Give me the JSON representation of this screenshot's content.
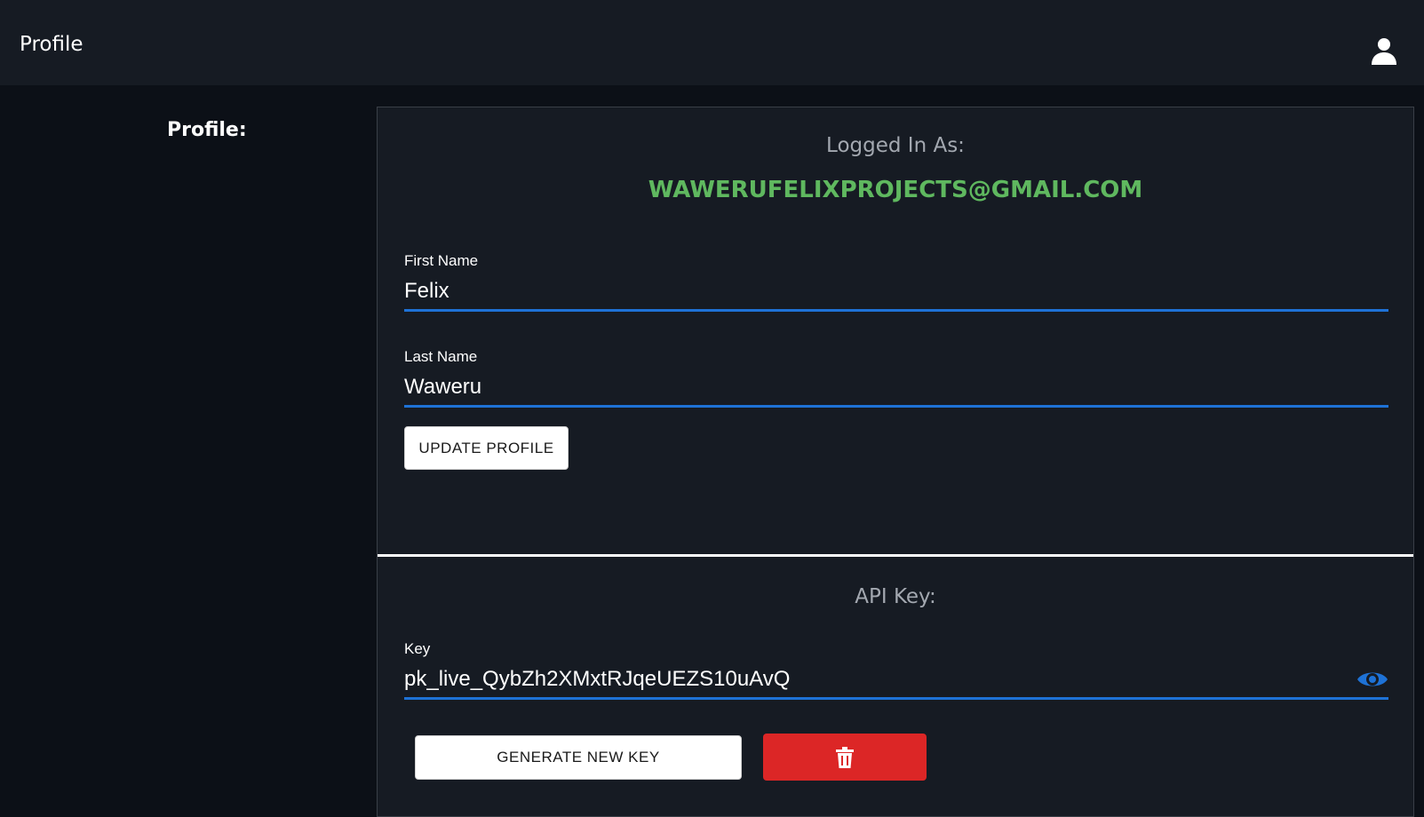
{
  "header": {
    "title": "Profile"
  },
  "sidebar": {
    "label": "Profile:"
  },
  "account": {
    "logged_in_label": "Logged In As:",
    "email": "WAWERUFELIXPROJECTS@GMAIL.COM"
  },
  "form": {
    "first_name": {
      "label": "First Name",
      "value": "Felix"
    },
    "last_name": {
      "label": "Last Name",
      "value": "Waweru"
    },
    "update_button": "UPDATE PROFILE"
  },
  "api": {
    "section_label": "API Key:",
    "key_label": "Key",
    "key_value": "pk_live_QybZh2XMxtRJqeUEZS10uAvQ",
    "generate_button": "GENERATE NEW KEY",
    "delete_icon": "trash-icon",
    "reveal_icon": "eye-icon"
  },
  "colors": {
    "accent": "#1e72d6",
    "email": "#5fb85f",
    "danger": "#dc2626",
    "background": "#0c1017",
    "panel": "#161b23"
  }
}
